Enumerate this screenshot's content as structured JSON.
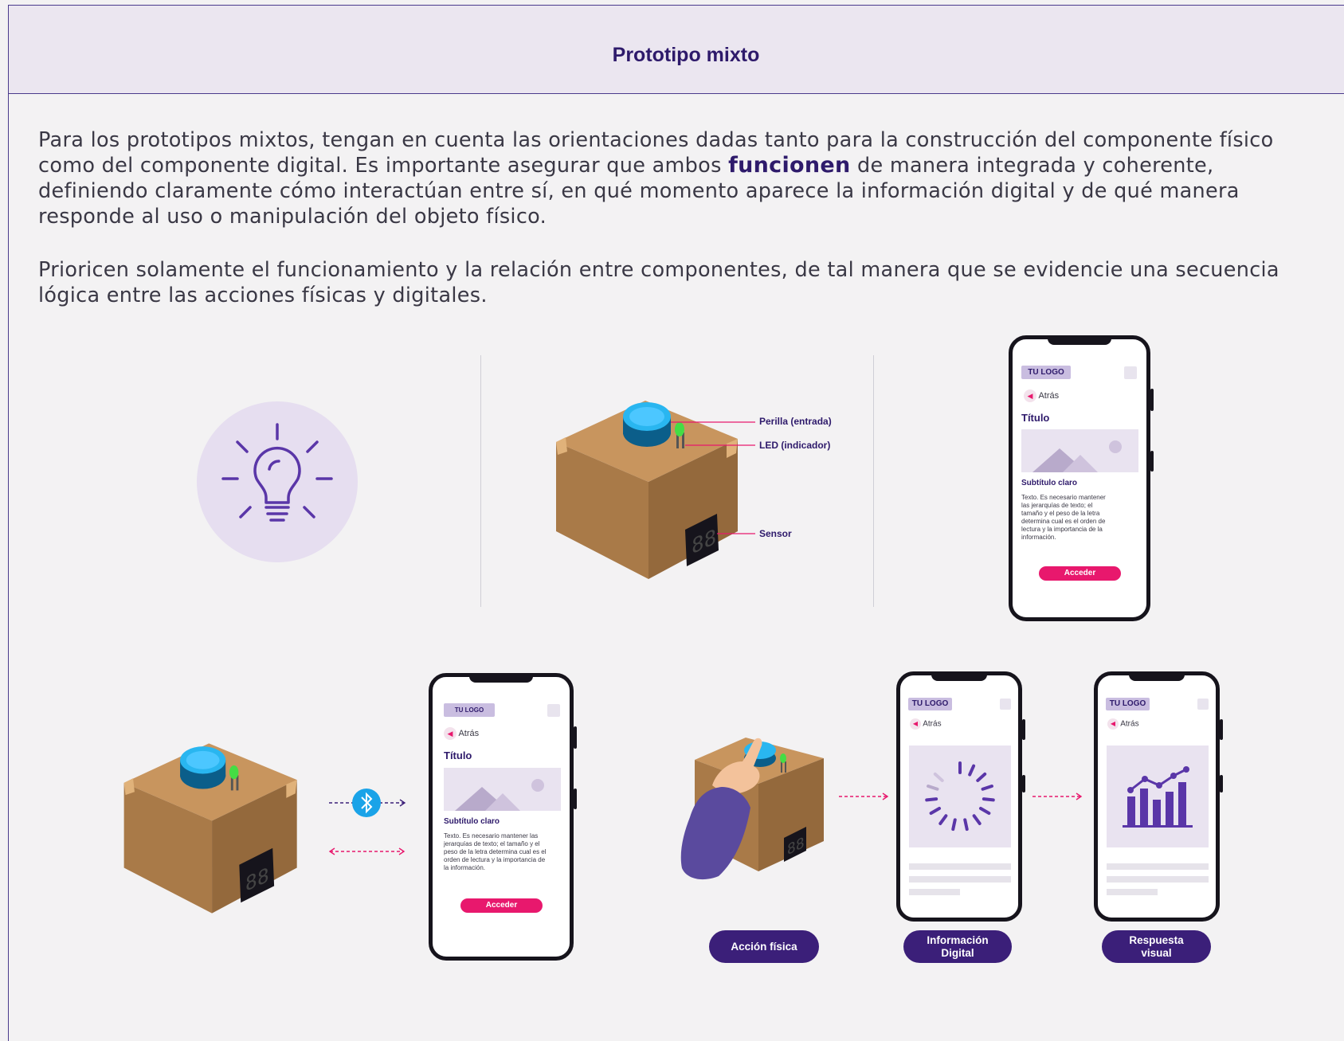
{
  "header": {
    "title": "Prototipo mixto"
  },
  "intro": {
    "p1_before": "Para los prototipos mixtos, tengan en cuenta las orientaciones dadas tanto para la construcción del componente físico como del componente digital. Es importante asegurar que ambos ",
    "p1_bold": "funcionen",
    "p1_after": " de manera integrada y coherente, definiendo claramente cómo interactúan entre sí, en qué momento aparece la información digital y de qué manera responde al uso o manipulación del objeto físico.",
    "p2": "Prioricen solamente el funcionamiento y la relación entre componentes, de tal manera que se evidencie una secuencia lógica entre las acciones físicas y digitales."
  },
  "callouts": {
    "knob": "Perilla (entrada)",
    "led": "LED (indicador)",
    "sensor": "Sensor"
  },
  "display_digits": "88",
  "phone": {
    "logo": "TU LOGO",
    "back": "Atrás",
    "title": "Título",
    "subtitle": "Subtítulo claro",
    "text": "Texto. Es necesario mantener las jerarquías de texto; el tamaño y el peso de la letra determina cual es el orden de lectura y la importancia de la información.",
    "button": "Acceder"
  },
  "sequence": {
    "step1": "Acción física",
    "step2": "Información Digital",
    "step3": "Respuesta visual"
  },
  "colors": {
    "primary": "#3b1f79",
    "accent": "#e8186d",
    "bluetooth": "#1aa3e8",
    "box": "#c8955e"
  },
  "icons": [
    "lightbulb-icon",
    "bluetooth-icon",
    "loading-spinner-icon",
    "bar-chart-icon",
    "mountain-image-icon",
    "hand-icon"
  ]
}
